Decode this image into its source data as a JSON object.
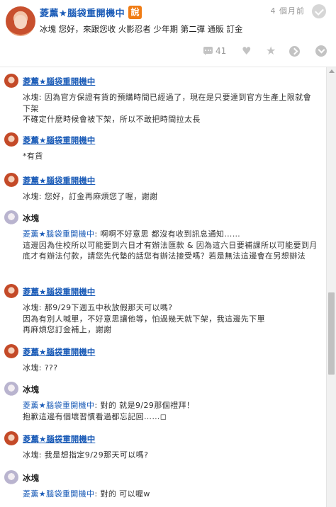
{
  "header": {
    "title": "菱薰★腦袋重開機中",
    "badge": "說",
    "time": "4 個月前",
    "message": "冰塊 您好，來跟您收 火影忍者 少年期 第二彈 通販 訂金",
    "comment_count": "41",
    "icons": {
      "comment": "comment-icon",
      "heart": "heart-icon",
      "star": "star-icon",
      "share": "share-icon",
      "more": "more-icon",
      "check": "check-icon"
    }
  },
  "replies": [
    {
      "name": "菱薰★腦袋重開機中",
      "lines": [
        "冰塊: 因為官方保證有貨的預購時間已經過了，現在是只要達到官方生產上限就會下架",
        "不確定什麼時候會被下架，所以不敢把時間拉太長"
      ]
    },
    {
      "name": "菱薰★腦袋重開機中",
      "lines": [
        "*有貨"
      ]
    },
    {
      "name": "菱薰★腦袋重開機中",
      "lines": [
        "冰塊: 您好，訂金再麻煩您了喔，謝謝"
      ]
    },
    {
      "name": "冰塊",
      "mention": "菱薰★腦袋重開機中",
      "lines": [
        ": 啊啊不好意思 都沒有收到訊息通知……",
        "這邊因為住校所以可能要到六日才有辦法匯款 & 因為這六日要補課所以可能要到月底才有辦法付款，請您先代墊的話您有辦法接受嗎？若是無法這邊會在另想辦法"
      ]
    },
    {
      "name": "菱薰★腦袋重開機中",
      "lines": [
        "冰塊: 那9/29下週五中秋放假那天可以嗎?",
        "因為有別人喊單，不好意思讓他等，怕過幾天就下架，我這邊先下單",
        "再麻煩您訂金補上，謝謝"
      ]
    },
    {
      "name": "菱薰★腦袋重開機中",
      "lines": [
        "冰塊: ???"
      ]
    },
    {
      "name": "冰塊",
      "mention": "菱薰★腦袋重開機中",
      "lines": [
        ": 對的 就是9/29那個禮拜！",
        "抱歉這邊有個壞習慣看過都忘記回……◻"
      ]
    },
    {
      "name": "菱薰★腦袋重開機中",
      "lines": [
        "冰塊: 我是想指定9/29那天可以嗎?"
      ]
    },
    {
      "name": "冰塊",
      "mention": "菱薰★腦袋重開機中",
      "lines": [
        ": 對的 可以喔w"
      ]
    }
  ],
  "colors": {
    "link": "#1a5bb7",
    "badge": "#f07c14",
    "icon_gray": "#c3c3c3",
    "time_gray": "#999999"
  }
}
